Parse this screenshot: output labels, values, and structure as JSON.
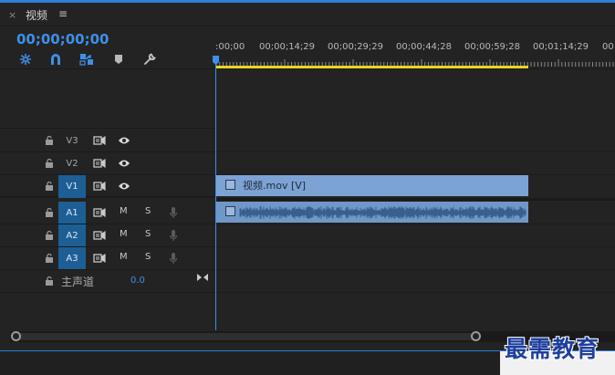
{
  "panel": {
    "close_glyph": "×",
    "title": "视频",
    "menu_glyph": "≡",
    "timecode": "00;00;00;00"
  },
  "toolbar": {
    "icons": [
      "nest-sequence-icon",
      "snap-magnet-icon",
      "linked-selection-icon",
      "add-marker-icon",
      "wrench-settings-icon"
    ]
  },
  "ruler": {
    "labels": [
      ":00;00",
      "00;00;14;29",
      "00;00;29;29",
      "00;00;44;28",
      "00;00;59;28",
      "00;01;14;29",
      "00"
    ]
  },
  "tracks": {
    "video": [
      {
        "name": "V3",
        "targeted": false
      },
      {
        "name": "V2",
        "targeted": false
      },
      {
        "name": "V1",
        "targeted": true
      }
    ],
    "audio": [
      {
        "name": "A1",
        "targeted": true,
        "mute": "M",
        "solo": "S"
      },
      {
        "name": "A2",
        "targeted": true,
        "mute": "M",
        "solo": "S"
      },
      {
        "name": "A3",
        "targeted": true,
        "mute": "M",
        "solo": "S"
      }
    ],
    "master": {
      "label": "主声道",
      "value": "0.0"
    }
  },
  "clips": {
    "video_clip_label": "视频.mov [V]"
  },
  "colors": {
    "accent": "#3f8fe6",
    "work_area": "#e8d521",
    "video_clip": "#7ca3d4",
    "audio_clip": "#6f98c9",
    "track_target": "#1d5e94"
  },
  "watermark": "最需教育"
}
